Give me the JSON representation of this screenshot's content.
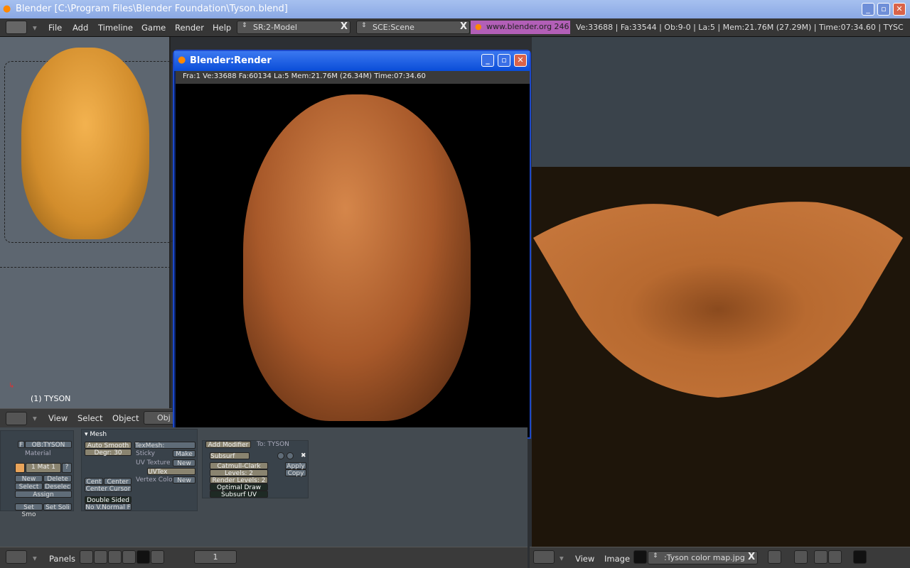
{
  "window": {
    "title": "Blender [C:\\Program Files\\Blender Foundation\\Tyson.blend]"
  },
  "header": {
    "menus": [
      "File",
      "Add",
      "Timeline",
      "Game",
      "Render",
      "Help"
    ],
    "screen": "SR:2-Model",
    "scene": "SCE:Scene",
    "site": "www.blender.org 246",
    "stats": "Ve:33688 | Fa:33544 | Ob:9-0 | La:5  | Mem:21.76M (27.29M)  | Time:07:34.60 | TYSC"
  },
  "view3d": {
    "object_label": "(1) TYSON",
    "menus": [
      "View",
      "Select",
      "Object"
    ],
    "mode": "Obj"
  },
  "render_window": {
    "title": "Blender:Render",
    "info": "Fra:1  Ve:33688 Fa:60134 La:5 Mem:21.76M (26.34M) Time:07:34.60"
  },
  "buttons": {
    "link": {
      "ob": "OB:TYSON",
      "f": "F",
      "material_label": "Material",
      "mat": "1 Mat 1",
      "q": "?",
      "new": "New",
      "delete": "Delete",
      "select": "Select",
      "deselect": "Deselec",
      "assign": "Assign",
      "set_smooth": "Set Smo",
      "set_solid": "Set Soli"
    },
    "mesh": {
      "title": "Mesh",
      "auto_smooth": "Auto Smooth",
      "degr": "Degr: 30",
      "texmesh": "TexMesh:",
      "sticky": "Sticky",
      "make": "Make",
      "uv_texture": "UV Texture",
      "uv_new": "New",
      "uvtex": "UVTex",
      "vertex_col": "Vertex Colo",
      "vc_new": "New",
      "cent": "Cent",
      "center": "Center",
      "center_cursor": "Center Cursor",
      "double_sided": "Double Sided",
      "no_vnormal": "No V.Normal F"
    },
    "modifiers": {
      "add": "Add Modifier",
      "to": "To: TYSON",
      "name": "Subsurf",
      "type": "Catmull-Clark",
      "levels": "Levels: 2",
      "render_levels": "Render Levels: 2",
      "optimal": "Optimal Draw",
      "subsurf_uv": "Subsurf UV",
      "apply": "Apply",
      "copy": "Copy"
    }
  },
  "buttons_header": {
    "panels": "Panels",
    "frame": "1"
  },
  "image_header": {
    "menus": [
      "View",
      "Image"
    ],
    "image": ":Tyson color map.jpg"
  },
  "colors": {
    "site_badge": "#b25fb7",
    "render_border": "#1d48c8",
    "skin": "#c0703a"
  }
}
